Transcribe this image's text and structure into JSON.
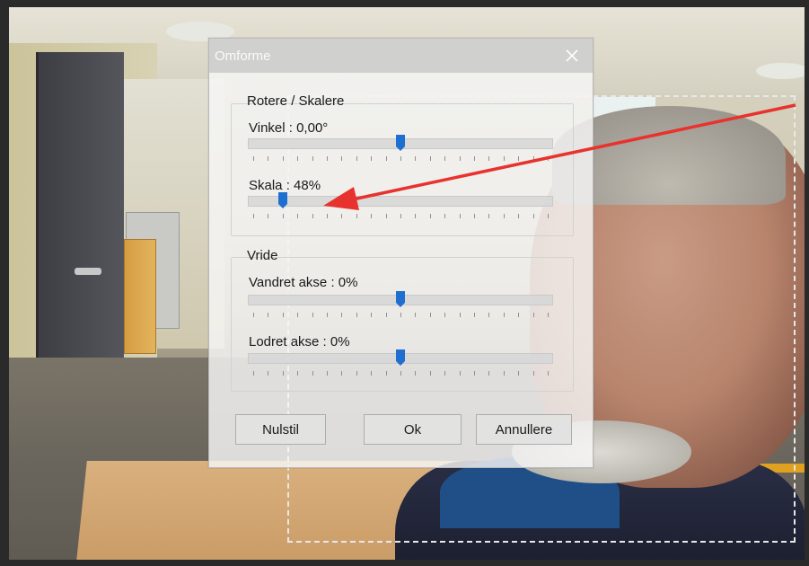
{
  "dialog": {
    "title": "Omforme",
    "close_icon": "close-icon",
    "groups": {
      "rotate_scale": {
        "label": "Rotere / Skalere",
        "angle_label": "Vinkel : 0,00°",
        "angle_value": 0.5,
        "scale_label": "Skala : 48%",
        "scale_value": 0.1
      },
      "skew": {
        "label": "Vride",
        "horizontal_label": "Vandret akse : 0%",
        "horizontal_value": 0.5,
        "vertical_label": "Lodret akse : 0%",
        "vertical_value": 0.5
      }
    },
    "buttons": {
      "reset": "Nulstil",
      "ok": "Ok",
      "cancel": "Annullere"
    }
  },
  "colors": {
    "slider_thumb": "#1f6fd1",
    "annotation_arrow": "#e8322e",
    "selection_border": "#e8e8e8"
  }
}
